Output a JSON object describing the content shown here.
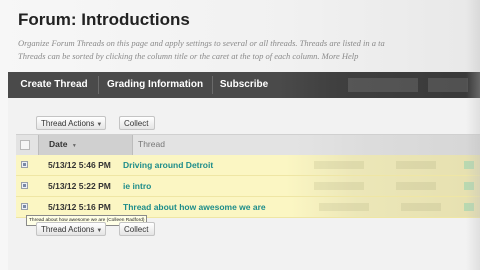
{
  "page": {
    "title": "Forum: Introductions",
    "description_lines": [
      "Organize Forum Threads on this page and apply settings to several or all threads. Threads are listed in a ta",
      "Threads can be sorted by clicking the column title or the caret at the top of each column. More Help"
    ]
  },
  "action_bar": {
    "create_thread": "Create Thread",
    "grading_information": "Grading Information",
    "subscribe": "Subscribe"
  },
  "toolbar": {
    "thread_actions": "Thread Actions",
    "collect": "Collect"
  },
  "table": {
    "headers": {
      "date": "Date",
      "thread": "Thread"
    },
    "rows": [
      {
        "date": "5/13/12 5:46 PM",
        "thread": "Driving around Detroit"
      },
      {
        "date": "5/13/12 5:22 PM",
        "thread": "ie intro"
      },
      {
        "date": "5/13/12 5:16 PM",
        "thread": "Thread about how awesome we are"
      }
    ]
  },
  "tooltip": "Thread about how awesome we are (Colleen Radford)",
  "colors": {
    "action_bar": "#4a4a4a",
    "row_highlight": "#fbf6c3",
    "thread_link": "#1c8c8a"
  }
}
